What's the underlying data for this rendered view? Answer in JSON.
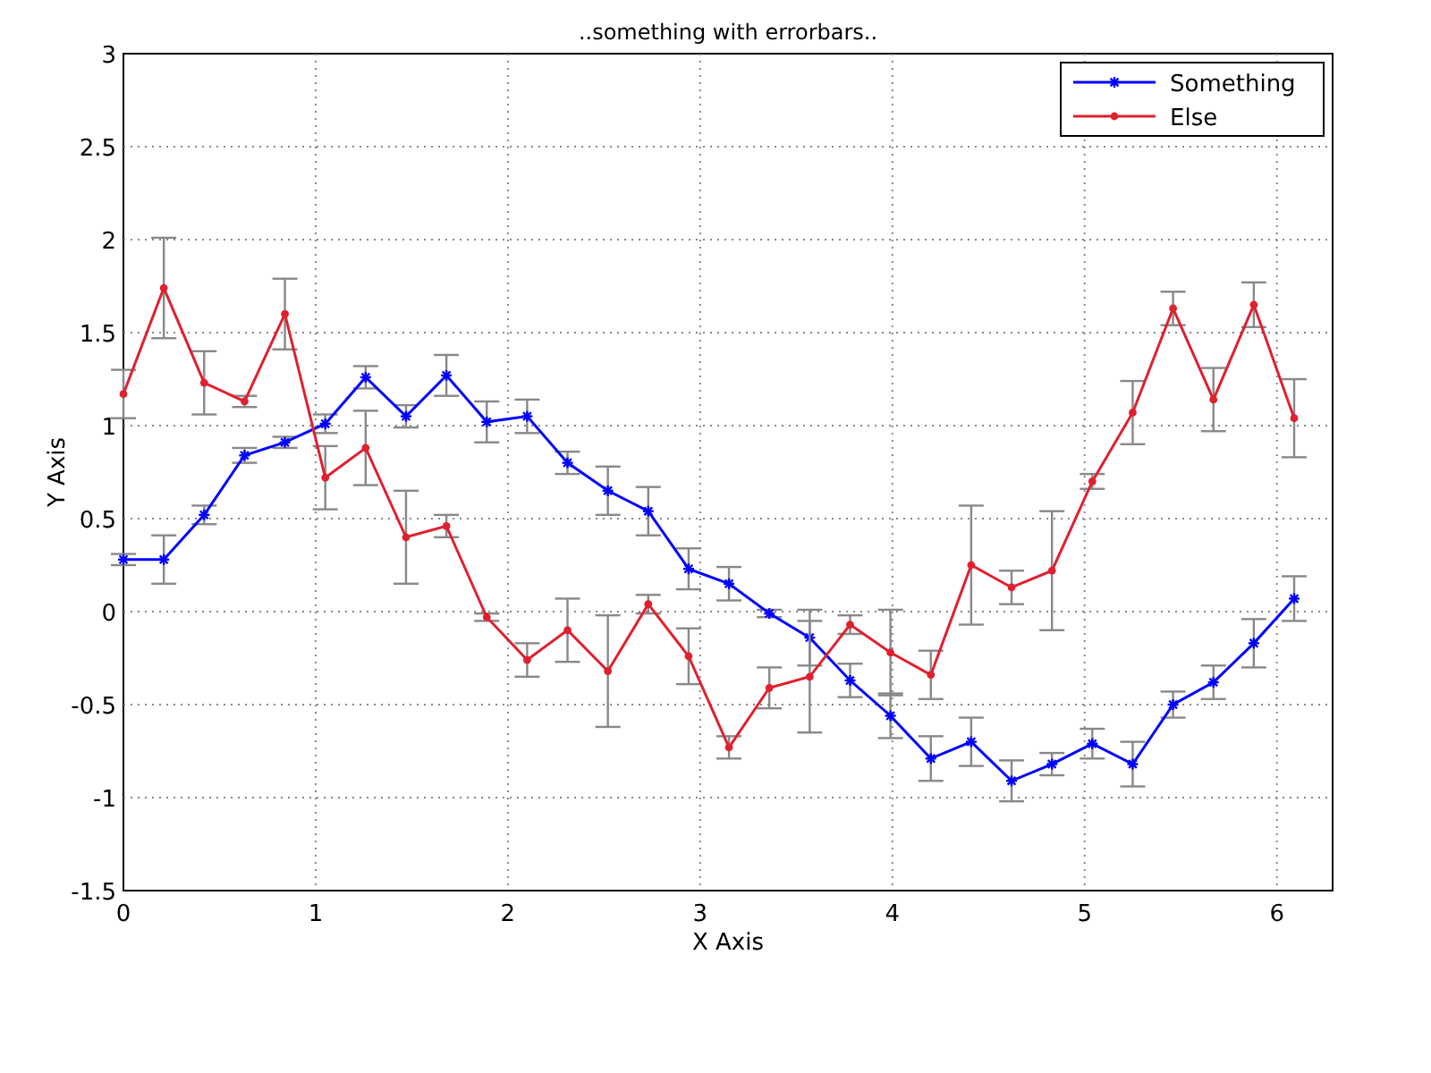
{
  "chart_data": {
    "type": "line",
    "title": "..something with errorbars..",
    "xlabel": "X Axis",
    "ylabel": "Y Axis",
    "x": [
      0,
      0.21,
      0.42,
      0.63,
      0.84,
      1.05,
      1.26,
      1.47,
      1.68,
      1.89,
      2.1,
      2.31,
      2.52,
      2.73,
      2.94,
      3.15,
      3.36,
      3.57,
      3.78,
      3.99,
      4.2,
      4.41,
      4.62,
      4.83,
      5.04,
      5.25,
      5.46,
      5.67,
      5.88,
      6.09
    ],
    "series": [
      {
        "name": "Something",
        "color": "#0000ff",
        "marker": "cross",
        "values": [
          0.28,
          0.28,
          0.52,
          0.84,
          0.91,
          1.01,
          1.26,
          1.05,
          1.27,
          1.02,
          1.05,
          0.8,
          0.65,
          0.54,
          0.23,
          0.15,
          -0.01,
          -0.14,
          -0.37,
          -0.56,
          -0.79,
          -0.7,
          -0.91,
          -0.82,
          -0.71,
          -0.82,
          -0.5,
          -0.38,
          -0.17,
          0.07
        ],
        "errors": [
          0.03,
          0.13,
          0.05,
          0.04,
          0.03,
          0.05,
          0.06,
          0.06,
          0.11,
          0.11,
          0.09,
          0.06,
          0.13,
          0.13,
          0.11,
          0.09,
          0.02,
          0.15,
          0.09,
          0.12,
          0.12,
          0.13,
          0.11,
          0.06,
          0.08,
          0.12,
          0.07,
          0.09,
          0.13,
          0.12
        ]
      },
      {
        "name": "Else",
        "color": "#e0202e",
        "marker": "circle",
        "values": [
          1.17,
          1.74,
          1.23,
          1.13,
          1.6,
          0.72,
          0.88,
          0.4,
          0.46,
          -0.03,
          -0.26,
          -0.1,
          -0.32,
          0.04,
          -0.24,
          -0.73,
          -0.41,
          -0.35,
          -0.07,
          -0.22,
          -0.34,
          0.25,
          0.13,
          0.22,
          0.7,
          1.07,
          1.63,
          1.14,
          1.65,
          1.04
        ],
        "errors": [
          0.13,
          0.27,
          0.17,
          0.03,
          0.19,
          0.17,
          0.2,
          0.25,
          0.06,
          0.02,
          0.09,
          0.17,
          0.3,
          0.05,
          0.15,
          0.06,
          0.11,
          0.3,
          0.05,
          0.23,
          0.13,
          0.32,
          0.09,
          0.32,
          0.04,
          0.17,
          0.09,
          0.17,
          0.12,
          0.21
        ]
      }
    ],
    "xlim": [
      0,
      6.29
    ],
    "ylim": [
      -1.5,
      3
    ],
    "grid": true,
    "legend": true,
    "xticks": [
      0,
      1,
      2,
      3,
      4,
      5,
      6
    ],
    "yticks": [
      -1.5,
      -1,
      -0.5,
      0,
      0.5,
      1,
      1.5,
      2,
      2.5,
      3
    ]
  }
}
